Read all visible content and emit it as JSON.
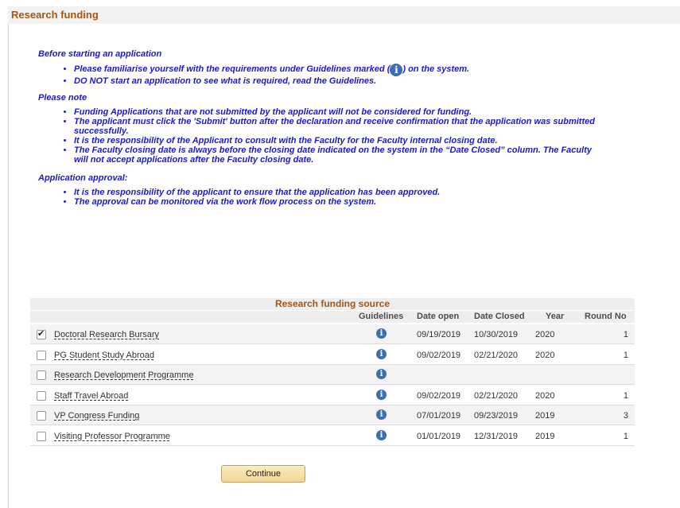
{
  "page": {
    "title": "Research funding"
  },
  "notice": {
    "section1_heading": "Before starting an application",
    "section1_items": [
      "Please familiarise yourself with the requirements under Guidelines marked (",
      ") on the system.",
      "DO NOT start an application to see what is required, read the Guidelines."
    ],
    "section2_heading": "Please note",
    "section2_items": [
      "Funding Applications that are not submitted by the applicant will not be considered for funding.",
      "The applicant must click the 'Submit' button after the declaration and receive confirmation that the application was submitted successfully.",
      "It is the responsibility of the Applicant to consult with the Faculty for the Faculty internal closing date.",
      "The Faculty closing date is always before the closing date indicated on the system in the “Date Closed” column. The Faculty will not accept applications after the Faculty closing date."
    ],
    "section3_heading": "Application approval:",
    "section3_items": [
      "It is the responsibility of the applicant to ensure that the application has been approved.",
      "The approval can be monitored via the work flow process on the system."
    ]
  },
  "grid": {
    "title": "Research funding source",
    "columns": {
      "guidelines": "Guidelines",
      "date_open": "Date open",
      "date_closed": "Date Closed",
      "year": "Year",
      "round_no": "Round No"
    },
    "rows": [
      {
        "name": "Doctoral Research Bursary",
        "checked": true,
        "date_open": "09/19/2019",
        "date_closed": "10/30/2019",
        "year": "2020",
        "round_no": "1"
      },
      {
        "name": "PG Student Study Abroad",
        "checked": false,
        "date_open": "09/02/2019",
        "date_closed": "02/21/2020",
        "year": "2020",
        "round_no": "1"
      },
      {
        "name": "Research Development Programme",
        "checked": false,
        "date_open": "",
        "date_closed": "",
        "year": "",
        "round_no": ""
      },
      {
        "name": "Staff Travel Abroad",
        "checked": false,
        "date_open": "09/02/2019",
        "date_closed": "02/21/2020",
        "year": "2020",
        "round_no": "1"
      },
      {
        "name": "VP Congress Funding",
        "checked": false,
        "date_open": "07/01/2019",
        "date_closed": "09/23/2019",
        "year": "2019",
        "round_no": "3"
      },
      {
        "name": "Visiting Professor Programme",
        "checked": false,
        "date_open": "01/01/2019",
        "date_closed": "12/31/2019",
        "year": "2019",
        "round_no": "1"
      }
    ],
    "info_glyph": "i"
  },
  "buttons": {
    "continue": "Continue"
  },
  "colors": {
    "title": "#a1561a",
    "notice": "#1a1ac8",
    "icon": "#3c6fae"
  }
}
